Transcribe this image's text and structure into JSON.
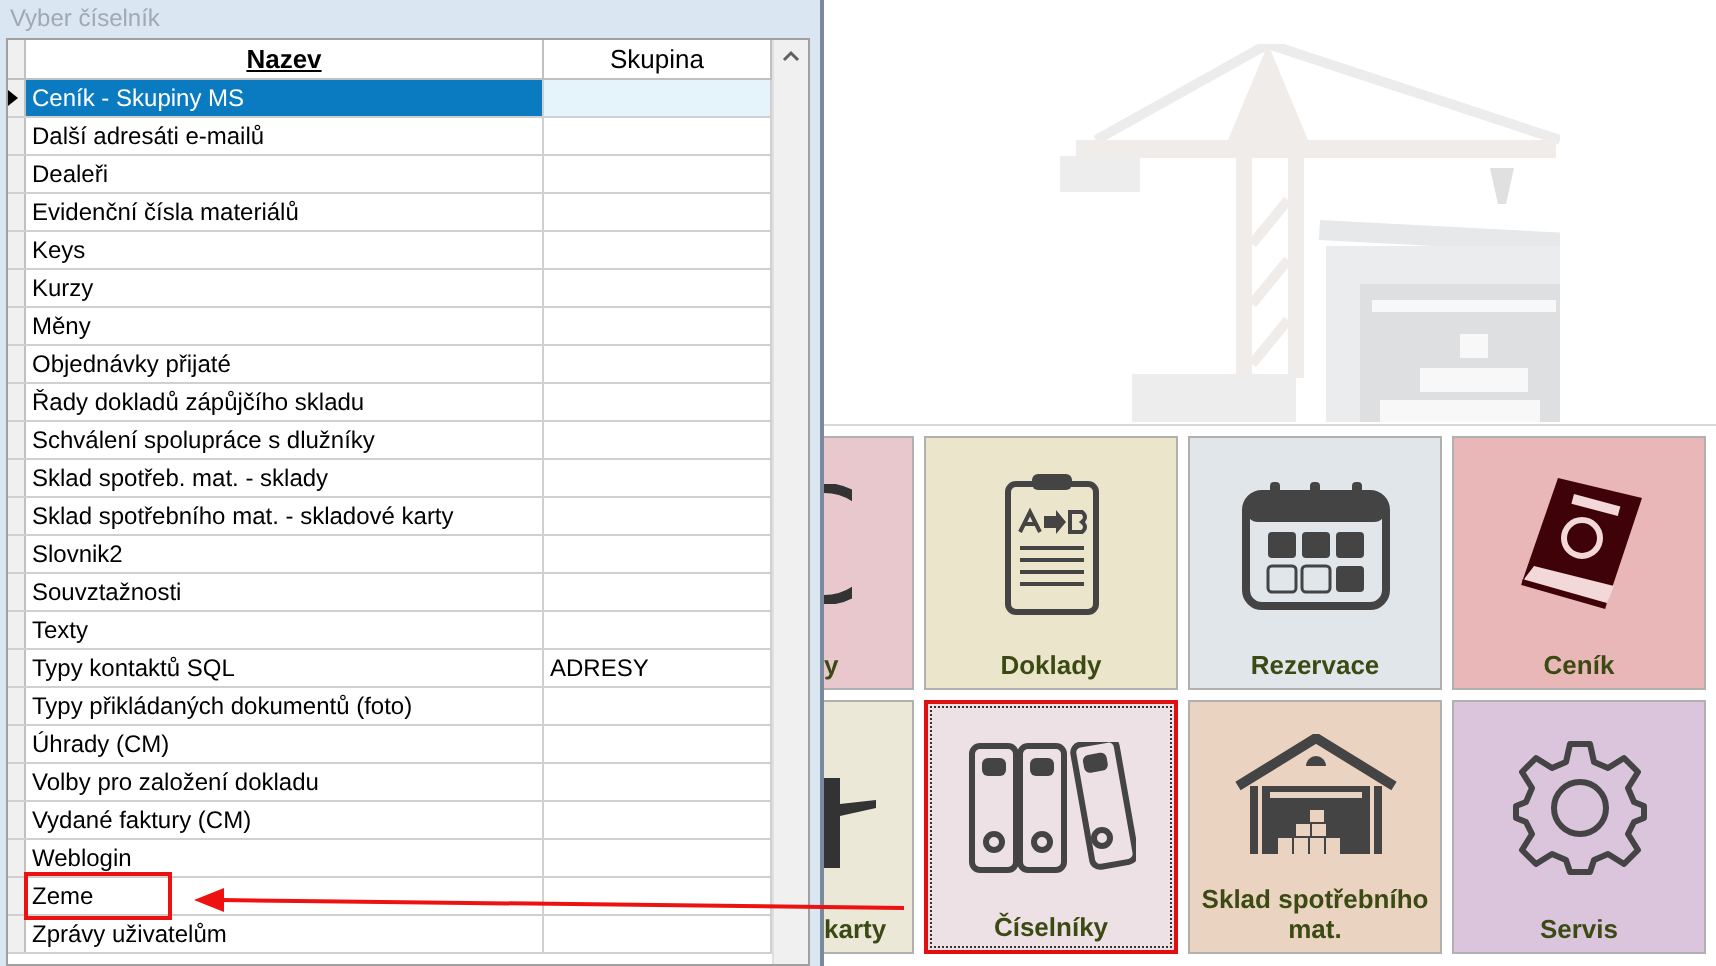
{
  "dialog": {
    "title": "Vyber číselník",
    "columns": [
      {
        "label": "Nazev",
        "sorted": true
      },
      {
        "label": "Skupina",
        "sorted": false
      }
    ],
    "rows": [
      {
        "nazev": "Ceník - Skupiny MS",
        "selected": true,
        "highlighted": false
      },
      {
        "nazev": "Další adresáti e-mailů",
        "selected": false,
        "highlighted": false
      },
      {
        "nazev": "Dealeři",
        "selected": false,
        "highlighted": false
      },
      {
        "nazev": "Evidenční čísla materiálů",
        "selected": false,
        "highlighted": false
      },
      {
        "nazev": "Keys",
        "selected": false,
        "highlighted": false
      },
      {
        "nazev": "Kurzy",
        "selected": false,
        "highlighted": false
      },
      {
        "nazev": "Měny",
        "selected": false,
        "highlighted": false
      },
      {
        "nazev": "Objednávky přijaté",
        "selected": false,
        "highlighted": false
      },
      {
        "nazev": "Řady dokladů zápůjčího skladu",
        "selected": false,
        "highlighted": false
      },
      {
        "nazev": "Schválení spolupráce s dlužníky",
        "selected": false,
        "highlighted": false
      },
      {
        "nazev": "Sklad spotřeb. mat. - sklady",
        "selected": false,
        "highlighted": false
      },
      {
        "nazev": "Sklad spotřebního mat. - skladové karty",
        "selected": false,
        "highlighted": false
      },
      {
        "nazev": "Slovnik2",
        "selected": false,
        "highlighted": false
      },
      {
        "nazev": "Souvztažnosti",
        "selected": false,
        "highlighted": false
      },
      {
        "nazev": "Texty",
        "selected": false,
        "highlighted": false
      },
      {
        "nazev": "Typy kontaktů SQL",
        "skupina": "ADRESY",
        "selected": false,
        "highlighted": false
      },
      {
        "nazev": "Typy přikládaných dokumentů (foto)",
        "selected": false,
        "highlighted": false
      },
      {
        "nazev": "Úhrady (CM)",
        "selected": false,
        "highlighted": false
      },
      {
        "nazev": "Volby pro založení dokladu",
        "selected": false,
        "highlighted": false
      },
      {
        "nazev": "Vydané faktury (CM)",
        "selected": false,
        "highlighted": false
      },
      {
        "nazev": "Weblogin",
        "selected": false,
        "highlighted": false
      },
      {
        "nazev": "Zeme",
        "selected": false,
        "highlighted": true
      },
      {
        "nazev": "Zprávy uživatelům",
        "selected": false,
        "highlighted": false
      }
    ]
  },
  "tiles": [
    {
      "label": "y",
      "kind": "partial-round",
      "color": "#e8c8cc",
      "selected": false
    },
    {
      "label": "Doklady",
      "kind": "clipboard",
      "color": "#ebe5cc",
      "selected": false
    },
    {
      "label": "Rezervace",
      "kind": "calendar",
      "color": "#e1e6ea",
      "selected": false
    },
    {
      "label": "Ceník",
      "kind": "book",
      "color": "#e9b7b7",
      "selected": false
    },
    {
      "label": "karty",
      "kind": "partial-tool",
      "color": "#ebe8d8",
      "selected": false
    },
    {
      "label": "Číselníky",
      "kind": "binders",
      "color": "#ede1e6",
      "selected": true
    },
    {
      "label": "Sklad spotřebního mat.",
      "kind": "warehouse",
      "color": "#ebd3c1",
      "selected": false
    },
    {
      "label": "Servis",
      "kind": "gear",
      "color": "#dac5dd",
      "selected": false
    }
  ]
}
